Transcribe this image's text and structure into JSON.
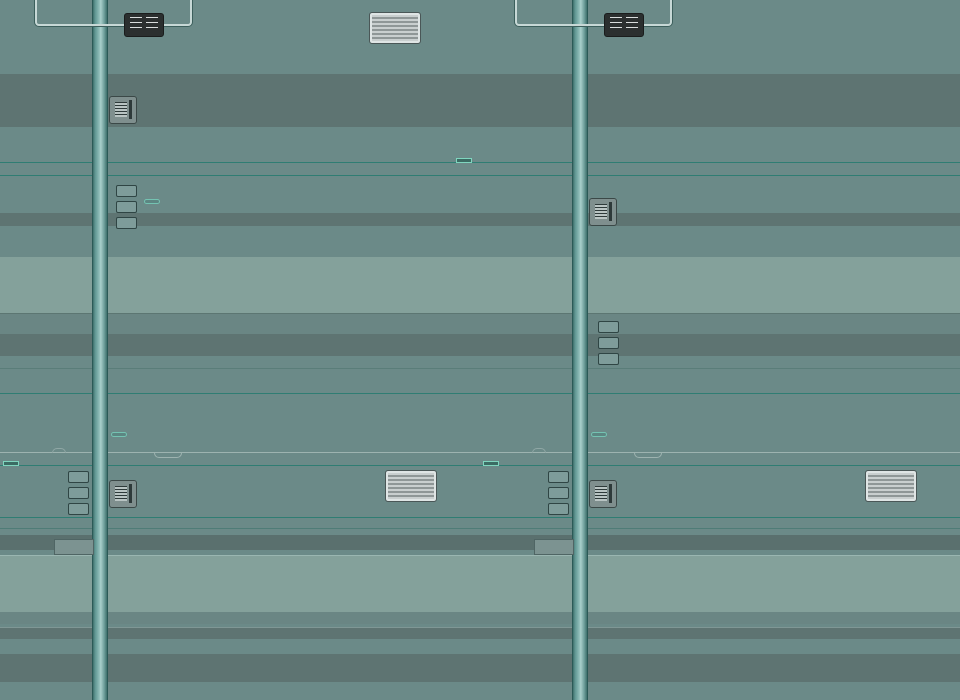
{
  "scene": {
    "description_free": true,
    "palette": {
      "background": "#6b8a88",
      "dark_band": "#5e7472",
      "light_band": "#84a19b",
      "mid_band": "#6a8684",
      "accent_line": "#2f7d73",
      "pipe_highlight": "#a9cfcb"
    },
    "icons": [
      "bracket-icon",
      "control-panel-icon",
      "vent-grille-icon",
      "wall-device-icon",
      "wall-button-icon",
      "indicator-light-icon"
    ]
  }
}
